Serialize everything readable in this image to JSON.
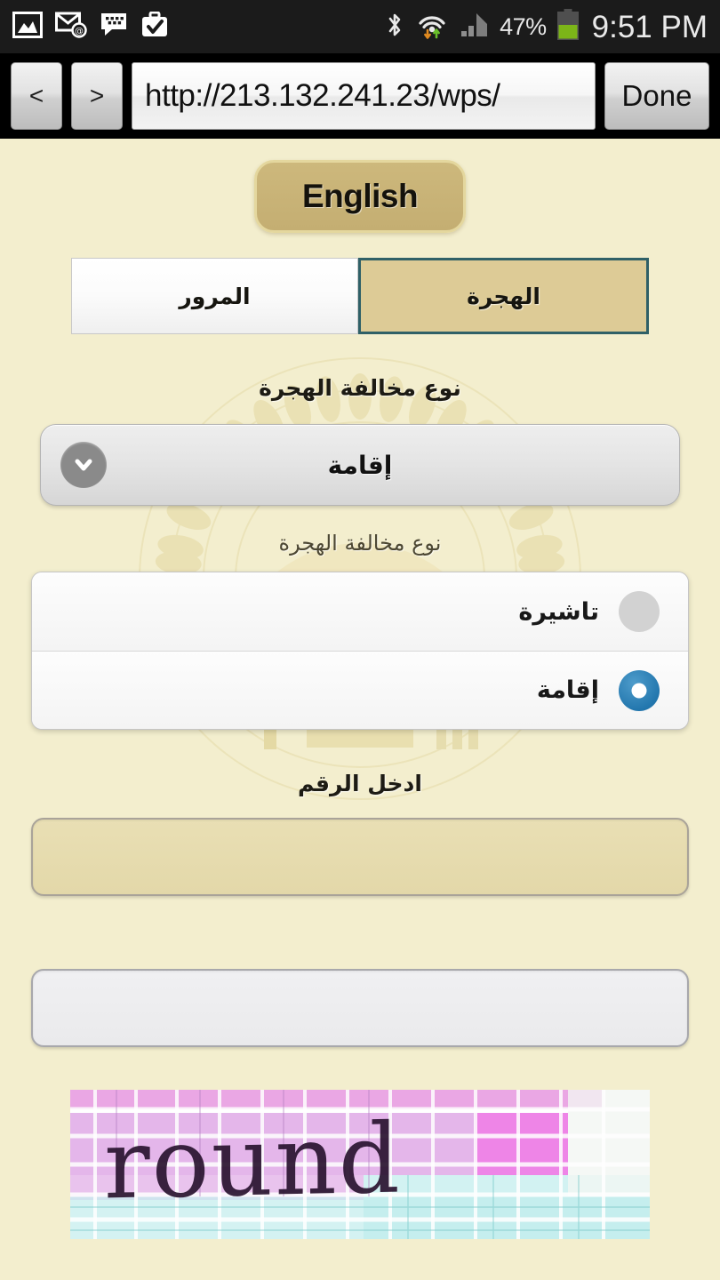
{
  "status_bar": {
    "icons_left": [
      "gallery-icon",
      "email-icon",
      "messaging-icon",
      "briefcase-check-icon"
    ],
    "icons_right": [
      "bluetooth-icon",
      "wifi-icon",
      "signal-icon"
    ],
    "battery_percent": "47%",
    "time": "9:51 PM"
  },
  "browser": {
    "back_label": "<",
    "forward_label": ">",
    "url": "http://213.132.241.23/wps/",
    "done_label": "Done"
  },
  "page": {
    "language_button": "English",
    "tabs": [
      {
        "label": "المرور",
        "active": false
      },
      {
        "label": "الهجرة",
        "active": true
      }
    ],
    "violation_type": {
      "label": "نوع مخالفة الهجرة",
      "selected_value": "إقامة"
    },
    "dropdown": {
      "title": "نوع مخالفة الهجرة",
      "options": [
        {
          "label": "تاشيرة",
          "selected": false
        },
        {
          "label": "إقامة",
          "selected": true
        }
      ]
    },
    "number_entry": {
      "label": "ادخل الرقم",
      "value": "",
      "placeholder": ""
    },
    "captcha_entry": {
      "value": "",
      "placeholder": ""
    },
    "captcha": {
      "text": "round"
    }
  },
  "colors": {
    "page_background": "#f3eece",
    "accent_gold": "#cdb87c",
    "tab_active_bg": "#ddcb96",
    "tab_active_border": "#2f6067",
    "radio_selected": "#2377ae",
    "input_focus_bg": "#e3d8a9",
    "captcha_pink": "#e89fe0",
    "captcha_cyan": "#b6ecec",
    "status_bar_bg": "#1b1b1b",
    "battery_green": "#7cb518"
  }
}
